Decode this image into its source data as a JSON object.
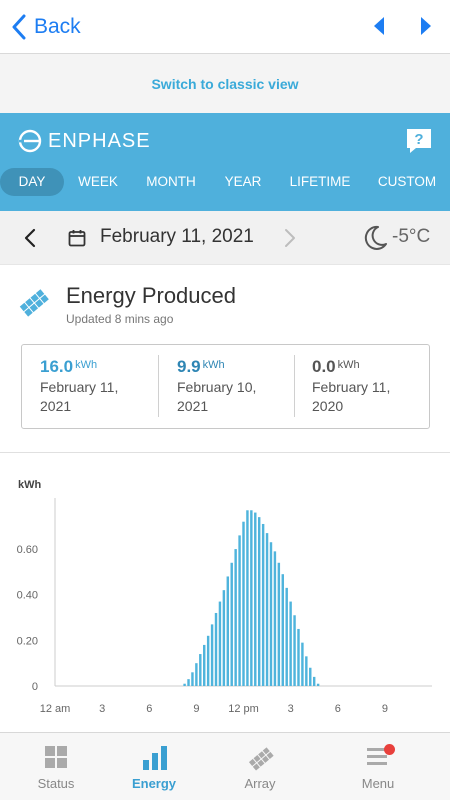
{
  "nav": {
    "back_label": "Back"
  },
  "classic_view": {
    "label": "Switch to classic view"
  },
  "header": {
    "brand": "ENPHASE",
    "periods": [
      {
        "label": "DAY",
        "active": true
      },
      {
        "label": "WEEK",
        "active": false
      },
      {
        "label": "MONTH",
        "active": false
      },
      {
        "label": "YEAR",
        "active": false
      },
      {
        "label": "LIFETIME",
        "active": false
      },
      {
        "label": "CUSTOM",
        "active": false
      }
    ]
  },
  "date_bar": {
    "date": "February 11, 2021",
    "temperature": "-5°C"
  },
  "energy": {
    "title": "Energy Produced",
    "updated": "Updated 8 mins ago",
    "stats": [
      {
        "value": "16.0",
        "unit": "kWh",
        "date_line1": "February 11,",
        "date_line2": "2021",
        "color": "#3a9fd1"
      },
      {
        "value": "9.9",
        "unit": "kWh",
        "date_line1": "February 10,",
        "date_line2": "2021",
        "color": "#2f86b4"
      },
      {
        "value": "0.0",
        "unit": "kWh",
        "date_line1": "February 11,",
        "date_line2": "2020",
        "color": "#555555"
      }
    ]
  },
  "chart_data": {
    "type": "bar",
    "ylabel": "kWh",
    "ylim": [
      0,
      0.78
    ],
    "yticks": [
      0,
      0.2,
      0.4,
      0.6
    ],
    "ytick_labels": [
      "0",
      "0.20",
      "0.40",
      "0.60"
    ],
    "xlim": [
      0,
      24
    ],
    "xticks": [
      0,
      3,
      6,
      9,
      12,
      15,
      18,
      21
    ],
    "xtick_labels": [
      "12 am",
      "3",
      "6",
      "9",
      "12 pm",
      "3",
      "6",
      "9"
    ],
    "bar_color": "#4fb4dc",
    "bars": [
      {
        "x": 8.25,
        "y": 0.01
      },
      {
        "x": 8.5,
        "y": 0.03
      },
      {
        "x": 8.75,
        "y": 0.06
      },
      {
        "x": 9.0,
        "y": 0.1
      },
      {
        "x": 9.25,
        "y": 0.14
      },
      {
        "x": 9.5,
        "y": 0.18
      },
      {
        "x": 9.75,
        "y": 0.22
      },
      {
        "x": 10.0,
        "y": 0.27
      },
      {
        "x": 10.25,
        "y": 0.32
      },
      {
        "x": 10.5,
        "y": 0.37
      },
      {
        "x": 10.75,
        "y": 0.42
      },
      {
        "x": 11.0,
        "y": 0.48
      },
      {
        "x": 11.25,
        "y": 0.54
      },
      {
        "x": 11.5,
        "y": 0.6
      },
      {
        "x": 11.75,
        "y": 0.66
      },
      {
        "x": 12.0,
        "y": 0.72
      },
      {
        "x": 12.25,
        "y": 0.77
      },
      {
        "x": 12.5,
        "y": 0.77
      },
      {
        "x": 12.75,
        "y": 0.76
      },
      {
        "x": 13.0,
        "y": 0.74
      },
      {
        "x": 13.25,
        "y": 0.71
      },
      {
        "x": 13.5,
        "y": 0.67
      },
      {
        "x": 13.75,
        "y": 0.63
      },
      {
        "x": 14.0,
        "y": 0.59
      },
      {
        "x": 14.25,
        "y": 0.54
      },
      {
        "x": 14.5,
        "y": 0.49
      },
      {
        "x": 14.75,
        "y": 0.43
      },
      {
        "x": 15.0,
        "y": 0.37
      },
      {
        "x": 15.25,
        "y": 0.31
      },
      {
        "x": 15.5,
        "y": 0.25
      },
      {
        "x": 15.75,
        "y": 0.19
      },
      {
        "x": 16.0,
        "y": 0.13
      },
      {
        "x": 16.25,
        "y": 0.08
      },
      {
        "x": 16.5,
        "y": 0.04
      },
      {
        "x": 16.75,
        "y": 0.01
      }
    ]
  },
  "tabbar": {
    "tabs": [
      {
        "label": "Status",
        "icon": "status-grid-icon",
        "active": false
      },
      {
        "label": "Energy",
        "icon": "energy-bars-icon",
        "active": true
      },
      {
        "label": "Array",
        "icon": "array-panels-icon",
        "active": false
      },
      {
        "label": "Menu",
        "icon": "menu-lines-icon",
        "active": false
      }
    ],
    "badge_color": "#e8403c"
  },
  "colors": {
    "accent": "#4fb0dc",
    "link": "#1d7df2"
  }
}
